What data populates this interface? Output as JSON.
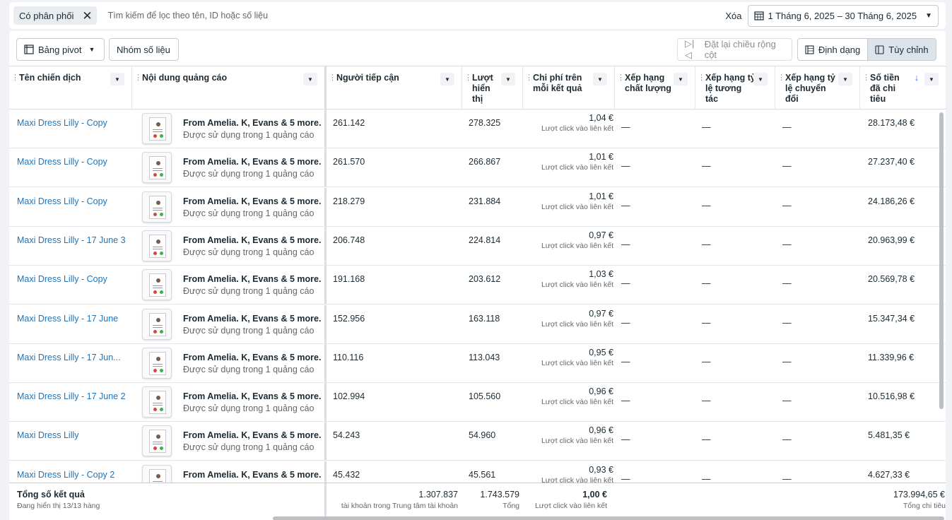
{
  "filter": {
    "chip_label": "Có phân phối",
    "search_placeholder": "Tìm kiếm để lọc theo tên, ID hoặc số liệu",
    "clear_label": "Xóa",
    "date_range": "1 Tháng 6, 2025 – 30 Tháng 6, 2025"
  },
  "toolbar": {
    "pivot_label": "Bảng pivot",
    "metric_group_label": "Nhóm số liệu",
    "reset_width_label": "Đặt lại chiều rộng cột",
    "format_label": "Định dạng",
    "customize_label": "Tùy chỉnh"
  },
  "columns": {
    "campaign": "Tên chiến dịch",
    "ad_content": "Nội dung quảng cáo",
    "reach": "Người tiếp cận",
    "impressions": "Lượt hiển thị",
    "cost_per_result": "Chi phí trên mỗi kết quả",
    "quality_ranking": "Xếp hạng chất lượng",
    "engagement_ranking": "Xếp hạng tỷ lệ tương tác",
    "conversion_ranking": "Xếp hạng tỷ lệ chuyển đổi",
    "amount_spent": "Số tiền đã chi tiêu"
  },
  "ad_title": "From Amelia. K, Evans & 5 more.",
  "ad_subtitle": "Được sử dụng trong 1 quảng cáo",
  "cost_label": "Lượt click vào liên kết",
  "dash": "—",
  "rows": [
    {
      "campaign": "Maxi Dress Lilly - Copy",
      "reach": "261.142",
      "impressions": "278.325",
      "cost": "1,04 €",
      "spent": "28.173,48 €"
    },
    {
      "campaign": "Maxi Dress Lilly - Copy",
      "reach": "261.570",
      "impressions": "266.867",
      "cost": "1,01 €",
      "spent": "27.237,40 €"
    },
    {
      "campaign": "Maxi Dress Lilly - Copy",
      "reach": "218.279",
      "impressions": "231.884",
      "cost": "1,01 €",
      "spent": "24.186,26 €"
    },
    {
      "campaign": "Maxi Dress Lilly - 17 June 3",
      "reach": "206.748",
      "impressions": "224.814",
      "cost": "0,97 €",
      "spent": "20.963,99 €"
    },
    {
      "campaign": "Maxi Dress Lilly - Copy",
      "reach": "191.168",
      "impressions": "203.612",
      "cost": "1,03 €",
      "spent": "20.569,78 €"
    },
    {
      "campaign": "Maxi Dress Lilly - 17 June",
      "reach": "152.956",
      "impressions": "163.118",
      "cost": "0,97 €",
      "spent": "15.347,34 €"
    },
    {
      "campaign": "Maxi Dress Lilly - 17 Jun...",
      "reach": "110.116",
      "impressions": "113.043",
      "cost": "0,95 €",
      "spent": "11.339,96 €"
    },
    {
      "campaign": "Maxi Dress Lilly - 17 June 2",
      "reach": "102.994",
      "impressions": "105.560",
      "cost": "0,96 €",
      "spent": "10.516,98 €"
    },
    {
      "campaign": "Maxi Dress Lilly",
      "reach": "54.243",
      "impressions": "54.960",
      "cost": "0,96 €",
      "spent": "5.481,35 €"
    },
    {
      "campaign": "Maxi Dress Lilly - Copy 2",
      "reach": "45.432",
      "impressions": "45.561",
      "cost": "0,93 €",
      "spent": "4.627,33 €"
    }
  ],
  "footer": {
    "title": "Tổng số kết quả",
    "subtitle": "Đang hiển thị 13/13 hàng",
    "reach_total": "1.307.837",
    "reach_note": "tài khoản trong Trung tâm tài khoản",
    "impressions_total": "1.743.579",
    "impressions_note": "Tổng",
    "cost_total": "1,00 €",
    "cost_note": "Lượt click vào liên kết",
    "spent_total": "173.994,65 €",
    "spent_note": "Tổng chi tiêu"
  },
  "icons": {
    "calendar": "calendar-icon",
    "pivot": "pivot-icon",
    "reset": "column-resize-icon",
    "format": "format-icon",
    "customize": "customize-icon"
  },
  "colors": {
    "link": "#1f74b8",
    "sort_arrow": "#1877f2",
    "active_segment": "#dde3ea"
  }
}
